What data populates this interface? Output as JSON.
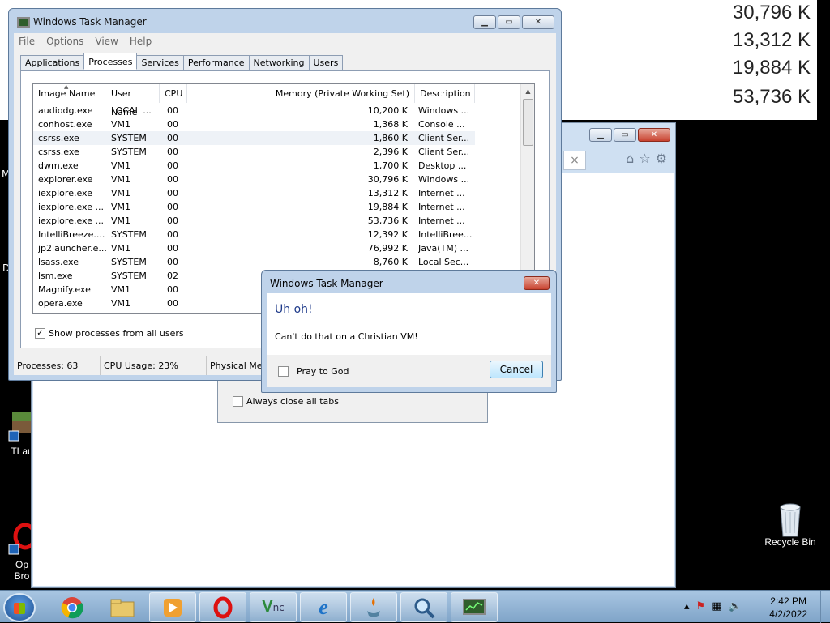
{
  "background_zoom": {
    "values": [
      "30,796 K",
      "13,312 K",
      "19,884 K",
      "53,736 K"
    ]
  },
  "desktop": {
    "icons": [
      {
        "label": "TLau",
        "icon": "minecraft-launcher-icon"
      },
      {
        "label": "Op\nBro",
        "icon": "opera-browser-icon"
      },
      {
        "label": "Recycle Bin",
        "icon": "recycle-bin-icon"
      }
    ],
    "edge_letters": [
      "M",
      "D"
    ]
  },
  "ie": {
    "tab_close": "×",
    "tools": [
      "home-icon",
      "favorites-star-icon",
      "gear-icon"
    ],
    "close_tabs_dialog": {
      "checkbox_label": "Always close all tabs"
    }
  },
  "task_manager": {
    "title": "Windows Task Manager",
    "menu": [
      "File",
      "Options",
      "View",
      "Help"
    ],
    "tabs": [
      "Applications",
      "Processes",
      "Services",
      "Performance",
      "Networking",
      "Users"
    ],
    "active_tab": "Processes",
    "columns": [
      "Image Name",
      "User Name",
      "CPU",
      "Memory (Private Working Set)",
      "Description"
    ],
    "processes": [
      {
        "name": "audiodg.exe",
        "user": "LOCAL ...",
        "cpu": "00",
        "mem": "10,200 K",
        "desc": "Windows ..."
      },
      {
        "name": "conhost.exe",
        "user": "VM1",
        "cpu": "00",
        "mem": "1,368 K",
        "desc": "Console ..."
      },
      {
        "name": "csrss.exe",
        "user": "SYSTEM",
        "cpu": "00",
        "mem": "1,860 K",
        "desc": "Client Ser..."
      },
      {
        "name": "csrss.exe",
        "user": "SYSTEM",
        "cpu": "00",
        "mem": "2,396 K",
        "desc": "Client Ser..."
      },
      {
        "name": "dwm.exe",
        "user": "VM1",
        "cpu": "00",
        "mem": "1,700 K",
        "desc": "Desktop ..."
      },
      {
        "name": "explorer.exe",
        "user": "VM1",
        "cpu": "00",
        "mem": "30,796 K",
        "desc": "Windows ..."
      },
      {
        "name": "iexplore.exe",
        "user": "VM1",
        "cpu": "00",
        "mem": "13,312 K",
        "desc": "Internet ..."
      },
      {
        "name": "iexplore.exe ...",
        "user": "VM1",
        "cpu": "00",
        "mem": "19,884 K",
        "desc": "Internet ..."
      },
      {
        "name": "iexplore.exe ...",
        "user": "VM1",
        "cpu": "00",
        "mem": "53,736 K",
        "desc": "Internet ..."
      },
      {
        "name": "IntelliBreeze....",
        "user": "SYSTEM",
        "cpu": "00",
        "mem": "12,392 K",
        "desc": "IntelliBree..."
      },
      {
        "name": "jp2launcher.e...",
        "user": "VM1",
        "cpu": "00",
        "mem": "76,992 K",
        "desc": "Java(TM) ..."
      },
      {
        "name": "lsass.exe",
        "user": "SYSTEM",
        "cpu": "00",
        "mem": "8,760 K",
        "desc": "Local Sec..."
      },
      {
        "name": "lsm.exe",
        "user": "SYSTEM",
        "cpu": "02",
        "mem": "",
        "desc": ""
      },
      {
        "name": "Magnify.exe",
        "user": "VM1",
        "cpu": "00",
        "mem": "",
        "desc": ""
      },
      {
        "name": "opera.exe",
        "user": "VM1",
        "cpu": "00",
        "mem": "",
        "desc": ""
      }
    ],
    "show_all_label": "Show processes from all users",
    "show_all_checked": "✓",
    "status": {
      "processes": "Processes: 63",
      "cpu": "CPU Usage: 23%",
      "memory": "Physical Me"
    }
  },
  "error_dialog": {
    "title": "Windows Task Manager",
    "heading": "Uh oh!",
    "message": "Can't do that on a Christian VM!",
    "checkbox_label": "Pray to God",
    "cancel_label": "Cancel"
  },
  "taskbar": {
    "pinned": [
      "chrome-icon",
      "file-explorer-icon",
      "media-player-icon",
      "opera-icon",
      "vnc-icon",
      "internet-explorer-icon",
      "java-icon",
      "magnifier-icon",
      "task-manager-icon"
    ],
    "time": "2:42 PM",
    "date": "4/2/2022"
  }
}
